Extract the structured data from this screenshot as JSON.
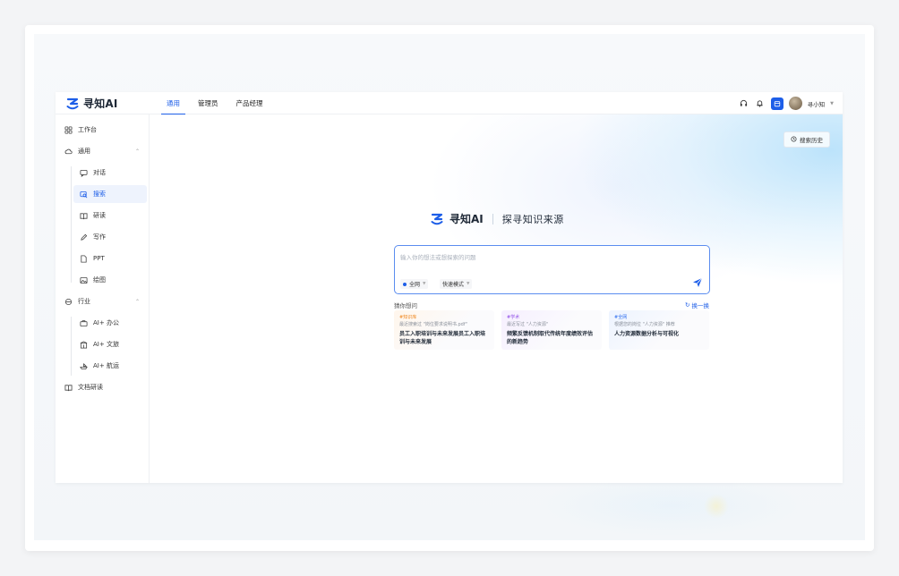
{
  "app": {
    "name": "寻知AI",
    "brand_color": "#1d5ee8"
  },
  "topnav": {
    "tabs": [
      {
        "label": "通用",
        "active": true
      },
      {
        "label": "管理员",
        "active": false
      },
      {
        "label": "产品经理",
        "active": false
      }
    ],
    "icons": [
      "headset-icon",
      "bell-icon",
      "calendar-icon"
    ],
    "username": "寻小知"
  },
  "sidebar": {
    "items": [
      {
        "label": "工作台",
        "icon": "grid-icon"
      },
      {
        "label": "通用",
        "icon": "cloud-icon",
        "expanded": true
      },
      {
        "label": "对话",
        "icon": "chat-icon"
      },
      {
        "label": "搜索",
        "icon": "search-icon",
        "active": true
      },
      {
        "label": "研读",
        "icon": "book-icon"
      },
      {
        "label": "写作",
        "icon": "pen-icon"
      },
      {
        "label": "PPT",
        "icon": "ppt-icon"
      },
      {
        "label": "绘图",
        "icon": "image-icon"
      },
      {
        "label": "行业",
        "icon": "industry-icon",
        "expanded": true
      },
      {
        "label": "AI+ 办公",
        "icon": "briefcase-icon"
      },
      {
        "label": "AI+ 文旅",
        "icon": "building-icon"
      },
      {
        "label": "AI+ 航运",
        "icon": "ship-icon"
      },
      {
        "label": "文档研读",
        "icon": "doc-book-icon"
      }
    ]
  },
  "main": {
    "history_label": "搜索历史",
    "hero_logo": "寻知AI",
    "slogan": "探寻知识来源",
    "search": {
      "placeholder": "输入你的想法或想探索的问题",
      "scope": "全网",
      "mode": "快速模式"
    },
    "guess_label": "猜你想问",
    "refresh_label": "换一换",
    "cards": [
      {
        "tag": "#知识库",
        "sub": "最近搜索过 \"岗位要求说明书.pdf\"",
        "question": "员工入职培训与未来发展员工入职培训与未来发展"
      },
      {
        "tag": "#学术",
        "sub": "最近写过 \"人力资源\"",
        "question": "频繁反馈机制取代传统年度绩效评估的新趋势"
      },
      {
        "tag": "#全网",
        "sub": "根据您的岗位 \"人力资源\" 推荐",
        "question": "人力资源数据分析与可视化"
      }
    ]
  }
}
